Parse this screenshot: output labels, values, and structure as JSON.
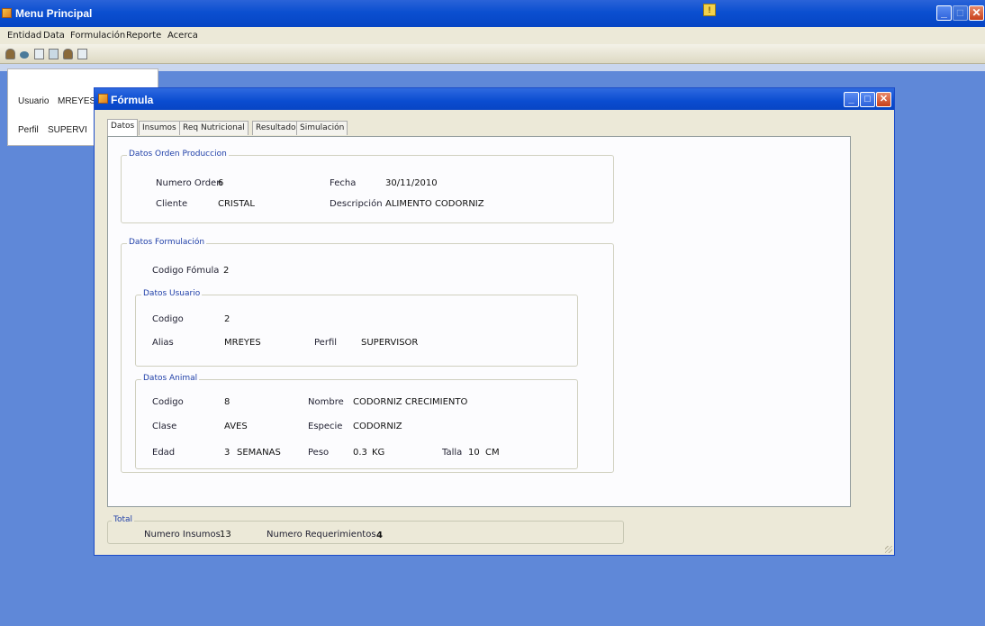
{
  "main_window": {
    "title": "Menu Principal",
    "menu": [
      "Entidad",
      "Data",
      "Formulación",
      "Reporte",
      "Acerca"
    ]
  },
  "session": {
    "user_label": "Usuario",
    "user_value": "MREYES",
    "profile_label": "Perfil",
    "profile_value": "SUPERVI"
  },
  "child_window": {
    "title": "Fórmula",
    "tabs": [
      "Datos",
      "Insumos",
      "Req Nutricional",
      "Resultado",
      "Simulación"
    ],
    "orden": {
      "legend": "Datos Orden Produccion",
      "numero_label": "Numero Orden",
      "numero_value": "6",
      "fecha_label": "Fecha",
      "fecha_value": "30/11/2010",
      "cliente_label": "Cliente",
      "cliente_value": "CRISTAL",
      "descripcion_label": "Descripción",
      "descripcion_value": "ALIMENTO CODORNIZ"
    },
    "formulacion": {
      "legend": "Datos Formulación",
      "codigo_label": "Codigo Fómula",
      "codigo_value": "2",
      "usuario": {
        "legend": "Datos Usuario",
        "codigo_label": "Codigo",
        "codigo_value": "2",
        "alias_label": "Alias",
        "alias_value": "MREYES",
        "perfil_label": "Perfil",
        "perfil_value": "SUPERVISOR"
      },
      "animal": {
        "legend": "Datos Animal",
        "codigo_label": "Codigo",
        "codigo_value": "8",
        "nombre_label": "Nombre",
        "nombre_value": "CODORNIZ CRECIMIENTO",
        "clase_label": "Clase",
        "clase_value": "AVES",
        "especie_label": "Especie",
        "especie_value": "CODORNIZ",
        "edad_label": "Edad",
        "edad_value": "3",
        "edad_unit": "SEMANAS",
        "peso_label": "Peso",
        "peso_value": "0.3",
        "peso_unit": "KG",
        "talla_label": "Talla",
        "talla_value": "10",
        "talla_unit": "CM"
      }
    },
    "total": {
      "legend": "Total",
      "insumos_label": "Numero Insumos",
      "insumos_value": "13",
      "req_label": "Numero Requerimientos",
      "req_value": "4"
    }
  },
  "colors": {
    "desktop": "#5f88d8",
    "titlebar": "#0a4cd0",
    "window_face": "#ece9d8",
    "group_legend": "#1f3fa8"
  }
}
